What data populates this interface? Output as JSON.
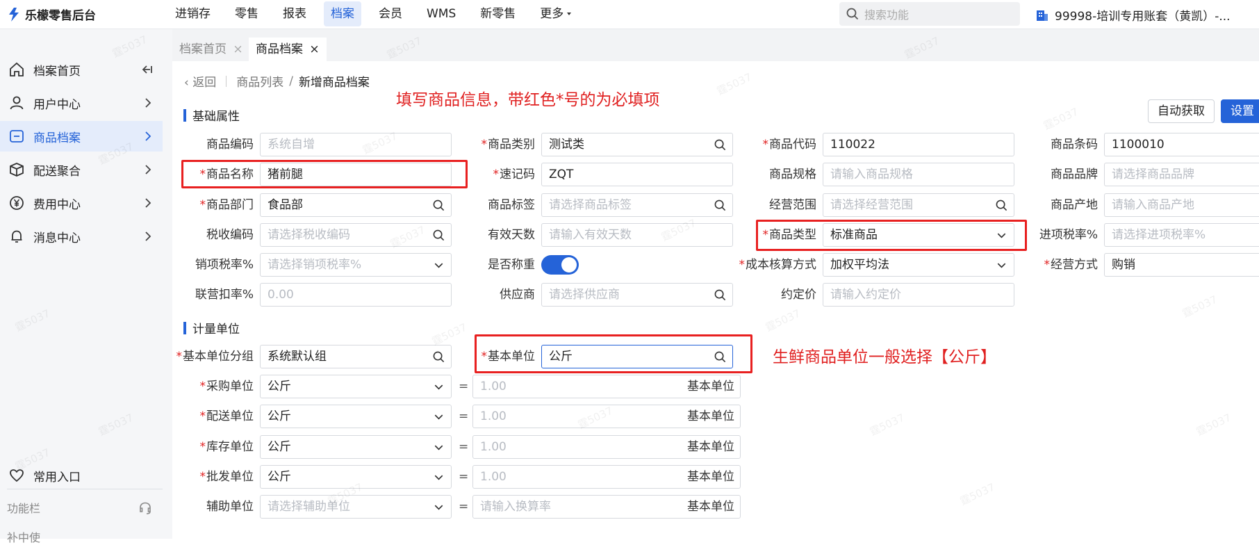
{
  "app": {
    "title": "乐檬零售后台"
  },
  "nav": [
    "进销存",
    "零售",
    "报表",
    "档案",
    "会员",
    "WMS",
    "新零售",
    "更多"
  ],
  "search": {
    "placeholder": "搜索功能"
  },
  "account": {
    "label": "99998-培训专用账套（黄凯）-..."
  },
  "sidebar": {
    "items": [
      {
        "label": "档案首页",
        "icon": "home-icon"
      },
      {
        "label": "用户中心",
        "icon": "user-icon"
      },
      {
        "label": "商品档案",
        "icon": "product-icon"
      },
      {
        "label": "配送聚合",
        "icon": "box-icon"
      },
      {
        "label": "费用中心",
        "icon": "yen-icon"
      },
      {
        "label": "消息中心",
        "icon": "bell-icon"
      }
    ],
    "favorites": "常用入口",
    "function_bar": "功能栏",
    "cut_item": "补中使"
  },
  "tabs": [
    "档案首页",
    "商品档案"
  ],
  "breadcrumb": {
    "back": "返回",
    "list": "商品列表",
    "current": "新增商品档案"
  },
  "annotations": {
    "top": "填写商品信息，带红色*号的为必填项",
    "unit": "生鲜商品单位一般选择【公斤】"
  },
  "buttons": {
    "auto_fetch": "自动获取",
    "settings": "设置"
  },
  "sections": {
    "basic": "基础属性",
    "units": "计量单位"
  },
  "fields": {
    "code": {
      "label": "商品编码",
      "placeholder": "系统自增"
    },
    "category": {
      "label": "商品类别",
      "value": "测试类"
    },
    "sku_code": {
      "label": "商品代码",
      "value": "110022"
    },
    "barcode": {
      "label": "商品条码",
      "value": "1100010"
    },
    "name": {
      "label": "商品名称",
      "value": "猪前腿"
    },
    "mnemonic": {
      "label": "速记码",
      "value": "ZQT"
    },
    "spec": {
      "label": "商品规格",
      "placeholder": "请输入商品规格"
    },
    "brand": {
      "label": "商品品牌",
      "placeholder": "请选择商品品牌"
    },
    "dept": {
      "label": "商品部门",
      "value": "食品部"
    },
    "tag": {
      "label": "商品标签",
      "placeholder": "请选择商品标签"
    },
    "scope": {
      "label": "经营范围",
      "placeholder": "请选择经营范围"
    },
    "origin": {
      "label": "商品产地",
      "placeholder": "请输入商品产地"
    },
    "tax_code": {
      "label": "税收编码",
      "placeholder": "请选择税收编码"
    },
    "shelf_days": {
      "label": "有效天数",
      "placeholder": "请输入有效天数"
    },
    "type": {
      "label": "商品类型",
      "value": "标准商品"
    },
    "input_tax": {
      "label": "进项税率%",
      "placeholder": "请选择进项税率%"
    },
    "output_tax": {
      "label": "销项税率%",
      "placeholder": "请选择销项税率%"
    },
    "weighing": {
      "label": "是否称重",
      "on": true
    },
    "cost_method": {
      "label": "成本核算方式",
      "value": "加权平均法"
    },
    "biz_mode": {
      "label": "经营方式",
      "value": "购销"
    },
    "joint_rate": {
      "label": "联营扣率%",
      "placeholder": "0.00"
    },
    "supplier": {
      "label": "供应商",
      "placeholder": "请选择供应商"
    },
    "agreed_price": {
      "label": "约定价",
      "placeholder": "请输入约定价"
    }
  },
  "units": {
    "group": {
      "label": "基本单位分组",
      "value": "系统默认组"
    },
    "base": {
      "label": "基本单位",
      "value": "公斤"
    },
    "eq": "=",
    "base_unit_label": "基本单位",
    "rows": [
      {
        "label": "采购单位",
        "value": "公斤",
        "ratio": "1.00",
        "required": true
      },
      {
        "label": "配送单位",
        "value": "公斤",
        "ratio": "1.00",
        "required": true
      },
      {
        "label": "库存单位",
        "value": "公斤",
        "ratio": "1.00",
        "required": true
      },
      {
        "label": "批发单位",
        "value": "公斤",
        "ratio": "1.00",
        "required": true
      },
      {
        "label": "辅助单位",
        "placeholder": "请选择辅助单位",
        "ratio_placeholder": "请输入换算率",
        "required": false
      }
    ]
  },
  "watermark": "霆5037"
}
